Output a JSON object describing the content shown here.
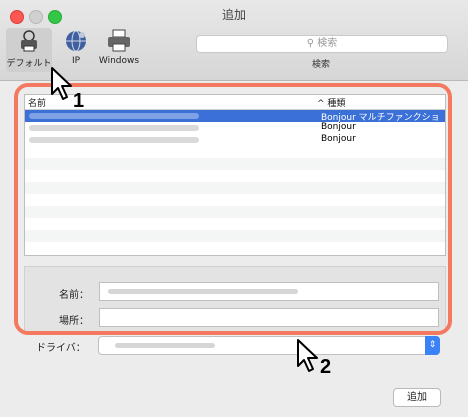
{
  "window": {
    "title": "追加"
  },
  "toolbar": {
    "default_label": "デフォルト",
    "ip_label": "IP",
    "windows_label": "Windows",
    "search_placeholder": "検索",
    "search_caption": "検索"
  },
  "list": {
    "columns": {
      "name": "名前",
      "kind": "種類",
      "sort_indicator": "^"
    },
    "rows": [
      {
        "kind": "Bonjour マルチファンクショ",
        "selected": true
      },
      {
        "kind": "Bonjour",
        "selected": false
      },
      {
        "kind": "Bonjour",
        "selected": false
      }
    ]
  },
  "form": {
    "name_label": "名前：",
    "location_label": "場所：",
    "driver_label": "ドライバ："
  },
  "buttons": {
    "add": "追加"
  },
  "annotations": {
    "step1": "1",
    "step2": "2"
  },
  "colors": {
    "highlight": "#f37a5f",
    "selection": "#3b70d8"
  }
}
